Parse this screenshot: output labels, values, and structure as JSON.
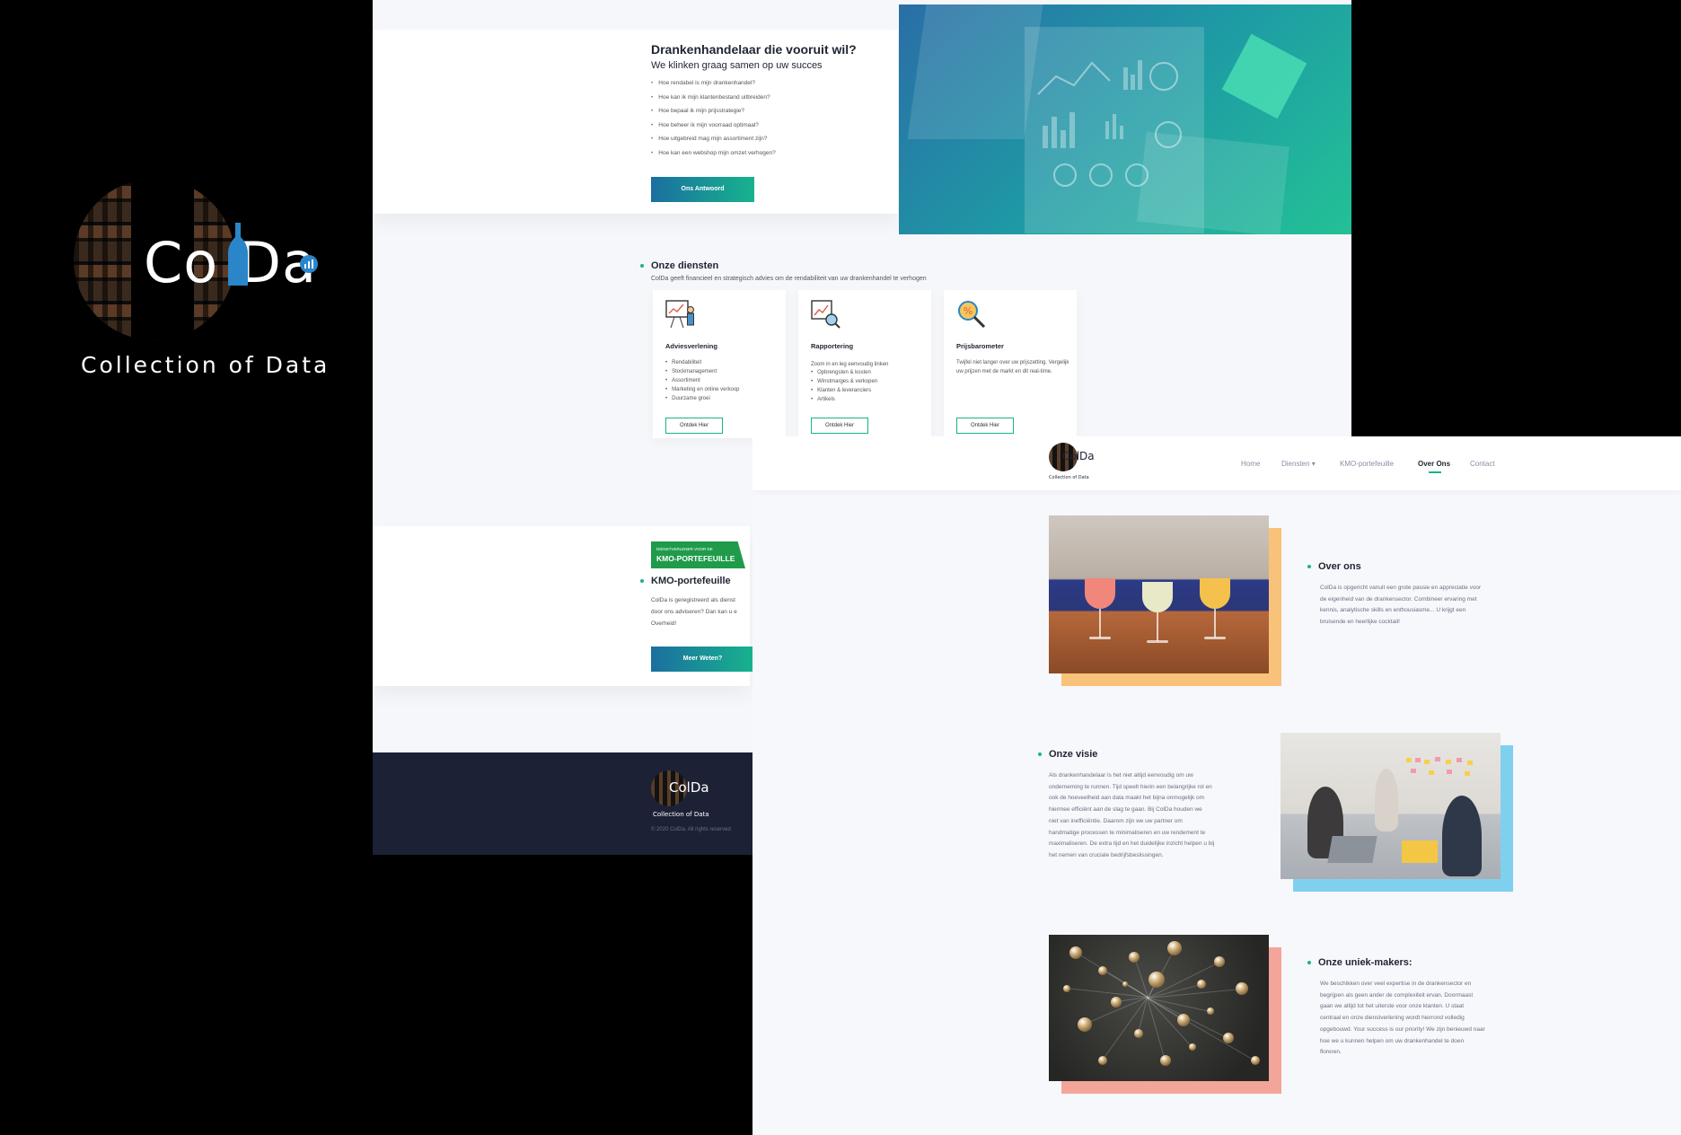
{
  "brand": {
    "name": "ColDa",
    "tagline": "Collection of Data"
  },
  "back_page": {
    "hero": {
      "title": "Drankenhandelaar die vooruit wil?",
      "subtitle": "We klinken graag samen op uw succes",
      "questions": [
        "Hoe rendabel is mijn drankenhandel?",
        "Hoe kan ik mijn klantenbestand uitbreiden?",
        "Hoe bepaal ik mijn prijsstrategie?",
        "Hoe beheer ik mijn voorraad optimaal?",
        "Hoe uitgebreid mag mijn assortiment zijn?",
        "Hoe kan een webshop mijn omzet verhogen?"
      ],
      "button": "Ons Antwoord"
    },
    "services": {
      "title": "Onze diensten",
      "subtitle": "ColDa geeft financieel en strategisch advies om de rendabiliteit van uw drankenhandel te verhogen",
      "cards": [
        {
          "title": "Adviesverlening",
          "items": [
            "Rendabiliteit",
            "Stockmanagement",
            "Assortiment",
            "Marketing en online verkoop",
            "Duurzame groei"
          ],
          "button": "Ontdek Hier"
        },
        {
          "title": "Rapportering",
          "intro": "Zoom in en leg eenvoudig linken",
          "items": [
            "Opbrengsten & kosten",
            "Winstmarges & verkopen",
            "Klanten & leveranciers",
            "Artikels"
          ],
          "button": "Ontdek Hier"
        },
        {
          "title": "Prijsbarometer",
          "text": "Twijfel niet langer over uw prijszetting. Vergelijk uw prijzen met de markt en dit real-time.",
          "button": "Ontdek Hier"
        }
      ]
    },
    "kmo": {
      "badge_small": "DIENSTVERLENER VOOR DE",
      "badge_big": "KMO-PORTEFEUILLE",
      "title": "KMO-portefeuille",
      "lines": [
        "ColDa is geregistreerd als dienst",
        "door ons adviseren? Dan kan u e",
        "Overheid!"
      ],
      "button": "Meer Weten?"
    },
    "footer": {
      "copyright": "© 2020 ColDa. All rights reserved"
    }
  },
  "front_page": {
    "nav": [
      {
        "label": "Home",
        "active": false
      },
      {
        "label": "Diensten ▾",
        "active": false
      },
      {
        "label": "KMO-portefeuille",
        "active": false
      },
      {
        "label": "Over Ons",
        "active": true
      },
      {
        "label": "Contact",
        "active": false
      }
    ],
    "sections": {
      "over_ons": {
        "title": "Over ons",
        "lines": [
          "ColDa is opgericht vanuit een grote passie en appreciatie voor",
          "de eigenheid van de drankensector. Combineer ervaring met",
          "kennis, analytische skills en enthousiasme... U krijgt een",
          "bruisende en heerlijke cocktail!"
        ]
      },
      "visie": {
        "title": "Onze visie",
        "lines": [
          "Als drankenhandelaar is het niet altijd eenvoudig om uw",
          "onderneming te runnen. Tijd speelt hierin een belangrijke rol en",
          "ook de hoeveelheid aan data maakt het bijna onmogelijk om",
          "hiermee efficiënt aan de slag te gaan. Bij ColDa houden we",
          "niet van inefficiëntie. Daarom zijn we uw partner om",
          "handmatige processen te minimaliseren en uw rendement te",
          "maximaliseren. De extra tijd en het duidelijke inzicht helpen u bij",
          "het nemen van cruciale bedrijfsbeslissingen."
        ]
      },
      "uniek": {
        "title": "Onze uniek-makers:",
        "lines": [
          "We beschikken over veel expertise in de drankensector en",
          "begrijpen als geen ander de complexiteit ervan. Doormaast",
          "gaan we altijd tot het uiterste voor onze klanten. U staat",
          "centraal en onze dienstverlening wordt hierrond volledig",
          "opgebouwd. Your success is our priority! We zijn benieuwd naar",
          "hoe we u kunnen helpen om uw drankenhandel te doen",
          "floreren."
        ]
      }
    }
  },
  "colors": {
    "accent_teal": "#17b38d",
    "accent_blue": "#1b6fa0",
    "footer_navy": "#1d2136",
    "shadow_orange": "#f9c27a",
    "shadow_blue": "#7fd0ef",
    "shadow_pink": "#f3a59a",
    "badge_green": "#1f9b4a"
  }
}
